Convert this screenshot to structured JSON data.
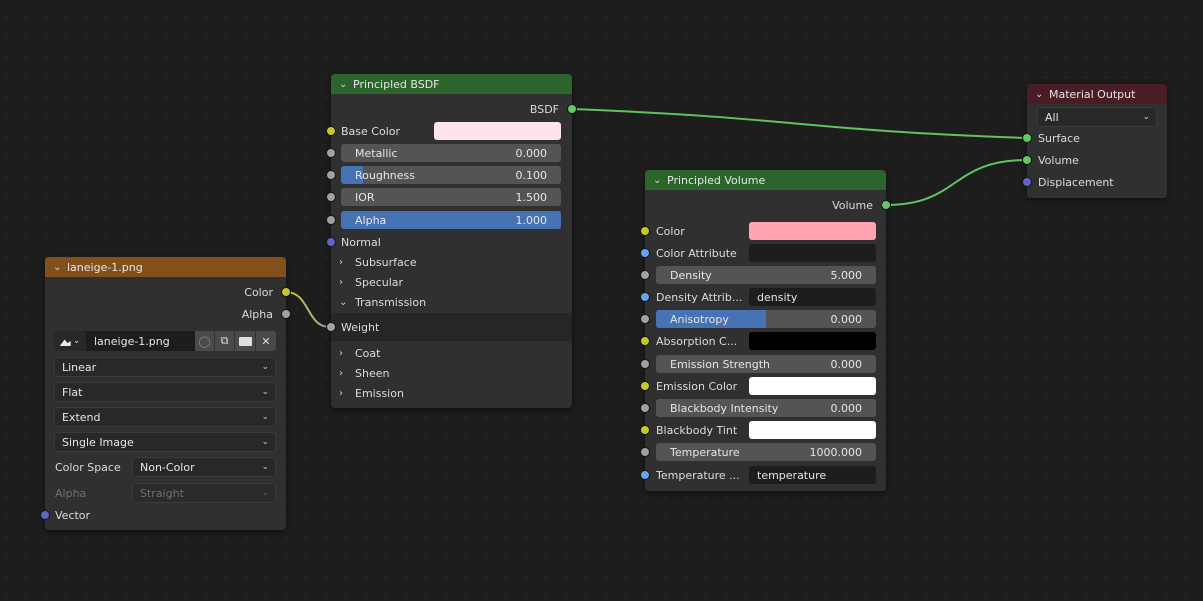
{
  "nodes": {
    "principled_bsdf": {
      "title": "Principled BSDF",
      "header_color": "#2b652b",
      "output": "BSDF",
      "base_color": {
        "label": "Base Color",
        "value": "#fde4ee"
      },
      "metallic": {
        "label": "Metallic",
        "value": "0.000",
        "fraction": 0.0
      },
      "roughness": {
        "label": "Roughness",
        "value": "0.100",
        "fraction": 0.1
      },
      "ior": {
        "label": "IOR",
        "value": "1.500",
        "fraction": 0.0
      },
      "alpha": {
        "label": "Alpha",
        "value": "1.000",
        "fraction": 1.0
      },
      "normal": "Normal",
      "panels": {
        "subsurface": "Subsurface",
        "specular": "Specular",
        "transmission": "Transmission",
        "weight": "Weight",
        "coat": "Coat",
        "sheen": "Sheen",
        "emission": "Emission"
      }
    },
    "image_texture": {
      "title": "laneige-1.png",
      "header_color": "#83501c",
      "outputs": {
        "color": "Color",
        "alpha": "Alpha"
      },
      "image_name": "laneige-1.png",
      "interpolation": "Linear",
      "projection": "Flat",
      "extension": "Extend",
      "source": "Single Image",
      "color_space_label": "Color Space",
      "color_space": "Non-Color",
      "alpha_label": "Alpha",
      "alpha_mode": "Straight",
      "vector": "Vector"
    },
    "principled_volume": {
      "title": "Principled Volume",
      "header_color": "#2b652b",
      "output": "Volume",
      "color": {
        "label": "Color",
        "value": "#ffa2b2"
      },
      "color_attribute": {
        "label": "Color Attribute",
        "value": ""
      },
      "density": {
        "label": "Density",
        "value": "5.000",
        "fraction": 0.0
      },
      "density_attribute": {
        "label": "Density Attrib...",
        "value": "density"
      },
      "anisotropy": {
        "label": "Anisotropy",
        "value": "0.000",
        "fraction": 0.5
      },
      "absorption_color": {
        "label": "Absorption C...",
        "value": "#000000"
      },
      "emission_strength": {
        "label": "Emission Strength",
        "value": "0.000",
        "fraction": 0.0
      },
      "emission_color": {
        "label": "Emission Color",
        "value": "#ffffff"
      },
      "blackbody_intensity": {
        "label": "Blackbody Intensity",
        "value": "0.000",
        "fraction": 0.0
      },
      "blackbody_tint": {
        "label": "Blackbody Tint",
        "value": "#ffffff"
      },
      "temperature": {
        "label": "Temperature",
        "value": "1000.000",
        "fraction": 0.0
      },
      "temperature_attribute": {
        "label": "Temperature ...",
        "value": "temperature"
      }
    },
    "material_output": {
      "title": "Material Output",
      "header_color": "#4a1c26",
      "target": "All",
      "inputs": {
        "surface": "Surface",
        "volume": "Volume",
        "displacement": "Displacement"
      }
    }
  }
}
